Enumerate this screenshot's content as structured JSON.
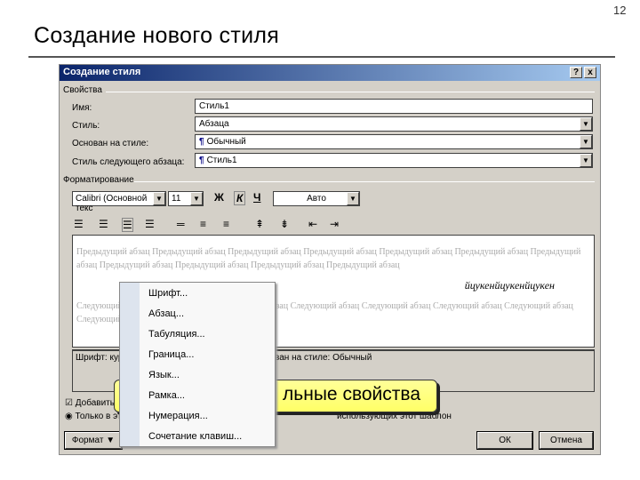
{
  "page_number": "12",
  "slide_title": "Создание нового стиля",
  "dialog": {
    "title": "Создание стиля",
    "help_button": "?",
    "close_button": "x",
    "properties_group": "Свойства",
    "fields": [
      {
        "label": "Имя:",
        "value": "Стиль1"
      },
      {
        "label": "Стиль:",
        "value": "Абзаца"
      },
      {
        "label": "Основан на стиле:",
        "value": "Обычный"
      },
      {
        "label": "Стиль следующего абзаца:",
        "value": "Стиль1"
      }
    ],
    "formatting_group": "Форматирование",
    "font": "Calibri (Основной текс",
    "size": "11",
    "bold": "Ж",
    "italic": "К",
    "underline": "Ч",
    "color": "Авто",
    "preview": {
      "previous": "Предыдущий абзац Предыдущий абзац Предыдущий абзац Предыдущий абзац Предыдущий абзац Предыдущий абзац Предыдущий абзац Предыдущий абзац Предыдущий абзац Предыдущий абзац Предыдущий абзац",
      "sample": "йцукенйцукенйцукен",
      "next": "Следующий абзац Следующий абзац Следующий абзац Следующий абзац Следующий абзац Следующий абзац Следующий абзац Следующий абзац Следующий абзац"
    },
    "description": "Шрифт: курсив, Стиль: Связанный, Стиль, Основан на стиле: Обычный",
    "add_checkbox": "Добавить",
    "radio": "Только в этом",
    "radio_tail": "использующих этот шаблон",
    "format_button": "Формат ▼",
    "ok": "ОК",
    "cancel": "Отмена"
  },
  "callout": "льные свойства",
  "menu": [
    "Шрифт...",
    "Абзац...",
    "Табуляция...",
    "Граница...",
    "Язык...",
    "Рамка...",
    "Нумерация...",
    "Сочетание клавиш..."
  ]
}
